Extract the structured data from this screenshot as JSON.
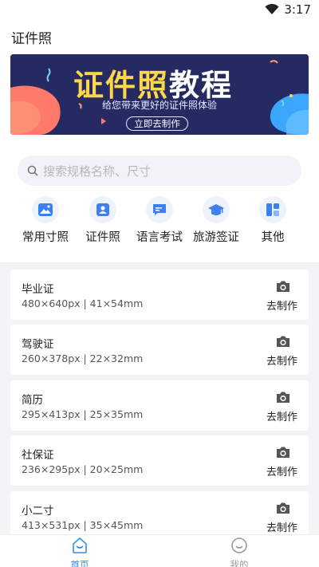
{
  "status_bar": {
    "time": "3:17",
    "wifi_icon": "wifi-icon"
  },
  "header": {
    "title": "证件照"
  },
  "banner": {
    "title_part1": "证件照",
    "title_part2": "教程",
    "subtitle": "给您带来更好的证件照体验",
    "button_label": "立即去制作",
    "colors": {
      "background": "#252a63",
      "title_highlight": "#ffd84a",
      "blob_left": "#ff7a6b",
      "blob_right": "#3aa7ff"
    }
  },
  "search": {
    "placeholder": "搜索规格名称、尺寸",
    "icon": "search-icon"
  },
  "categories": [
    {
      "label": "常用寸照",
      "icon": "image-icon"
    },
    {
      "label": "证件照",
      "icon": "id-card-icon"
    },
    {
      "label": "语言考试",
      "icon": "chat-icon"
    },
    {
      "label": "旅游签证",
      "icon": "graduation-cap-icon"
    },
    {
      "label": "其他",
      "icon": "grid-icon"
    }
  ],
  "items": [
    {
      "name": "毕业证",
      "spec": "480×640px | 41×54mm",
      "action": "去制作"
    },
    {
      "name": "驾驶证",
      "spec": "260×378px | 22×32mm",
      "action": "去制作"
    },
    {
      "name": "简历",
      "spec": "295×413px | 25×35mm",
      "action": "去制作"
    },
    {
      "name": "社保证",
      "spec": "236×295px | 20×25mm",
      "action": "去制作"
    },
    {
      "name": "小二寸",
      "spec": "413×531px | 35×45mm",
      "action": "去制作"
    }
  ],
  "tabbar": {
    "tabs": [
      {
        "label": "首页",
        "active": true,
        "icon": "home-icon"
      },
      {
        "label": "我的",
        "active": false,
        "icon": "profile-icon"
      }
    ],
    "colors": {
      "active": "#3a8ee6",
      "inactive": "#9a9a9a"
    }
  }
}
